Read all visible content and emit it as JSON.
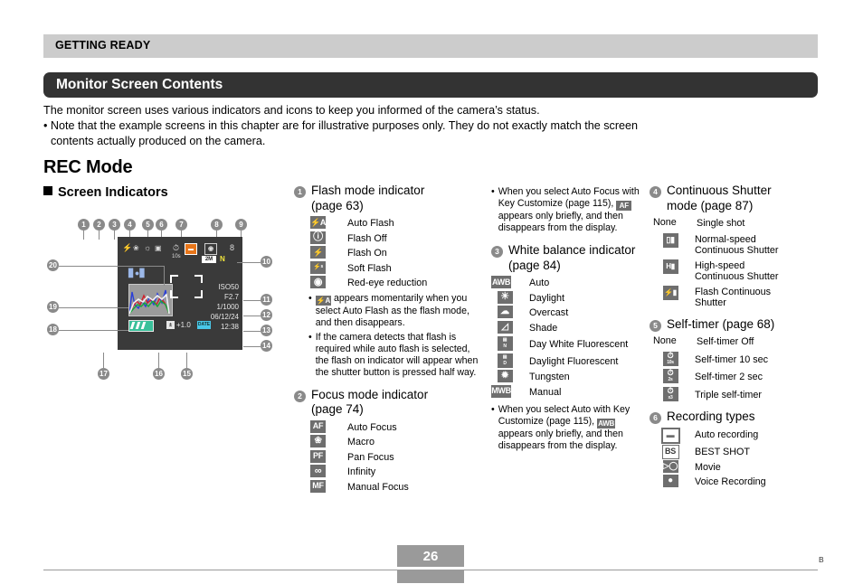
{
  "chapter_bar": {
    "label": "GETTING READY"
  },
  "title_bar": {
    "label": "Monitor Screen Contents"
  },
  "intro": {
    "line1": "The monitor screen uses various indicators and icons to keep you informed of the camera’s status.",
    "line2": "• Note that the example screens in this chapter are for illustrative purposes only. They do not exactly match the screen",
    "line3": "contents actually produced on the camera."
  },
  "headings": {
    "h1": "REC Mode",
    "h2": "Screen Indicators"
  },
  "screen": {
    "indicator_numbers": [
      "1",
      "2",
      "3",
      "4",
      "5",
      "6",
      "7",
      "8",
      "9",
      "10",
      "11",
      "12",
      "13",
      "14",
      "15",
      "16",
      "17",
      "18",
      "19",
      "20"
    ],
    "values": {
      "self_timer": "10s",
      "memory_left": "8",
      "image_size": "2M",
      "quality": "N",
      "iso": "ISO50",
      "aperture": "F2.7",
      "shutter": "1/1000",
      "date": "06/12/24",
      "time": "12:38",
      "ev": "+1.0",
      "date_stamp": "DATE"
    }
  },
  "sections": {
    "flash": {
      "number": "1",
      "title": "Flash mode indicator (page 63)",
      "title_l1": "Flash mode indicator",
      "title_l2": "(page 63)",
      "items": [
        {
          "icon": "flash-auto-icon",
          "glyph": "⚡A",
          "label": "Auto Flash"
        },
        {
          "icon": "flash-off-icon",
          "glyph": "ⓧ",
          "label": "Flash Off"
        },
        {
          "icon": "flash-on-icon",
          "glyph": "⚡",
          "label": "Flash On"
        },
        {
          "icon": "soft-flash-icon",
          "glyph": "⚡s",
          "label": "Soft Flash"
        },
        {
          "icon": "red-eye-icon",
          "glyph": "◉",
          "label": "Red-eye reduction"
        }
      ],
      "notes": [
        "appears momentarily when you select Auto Flash as the flash mode, and then disappears.",
        "If the camera detects that flash is required while auto flash is selected, the flash on indicator will appear when the shutter button is pressed half way."
      ]
    },
    "focus": {
      "number": "2",
      "title_l1": "Focus mode indicator",
      "title_l2": "(page 74)",
      "items": [
        {
          "icon": "auto-focus-icon",
          "glyph": "AF",
          "label": "Auto Focus"
        },
        {
          "icon": "macro-icon",
          "glyph": "❀",
          "label": "Macro"
        },
        {
          "icon": "pan-focus-icon",
          "glyph": "PF",
          "label": "Pan Focus"
        },
        {
          "icon": "infinity-icon",
          "glyph": "∞",
          "label": "Infinity"
        },
        {
          "icon": "manual-focus-icon",
          "glyph": "MF",
          "label": "Manual Focus"
        }
      ],
      "note": "When you select Auto Focus with Key Customize (page 115), AF appears only briefly, and then disappears from the display.",
      "note_pre": "When you select Auto Focus with Key Customize (page",
      "note_mid": "115),",
      "note_post": "appears only briefly, and then disappears from the display.",
      "note_glyph": "AF"
    },
    "white_balance": {
      "number": "3",
      "title_l1": "White balance indicator",
      "title_l2": "(page 84)",
      "items": [
        {
          "icon": "awb-icon",
          "glyph": "AWB",
          "label": "Auto"
        },
        {
          "icon": "daylight-icon",
          "glyph": "☀",
          "label": "Daylight"
        },
        {
          "icon": "overcast-icon",
          "glyph": "☁",
          "label": "Overcast"
        },
        {
          "icon": "shade-icon",
          "glyph": "◢",
          "label": "Shade"
        },
        {
          "icon": "day-white-fluorescent-icon",
          "glyph": "N",
          "label": "Day White Fluorescent"
        },
        {
          "icon": "daylight-fluorescent-icon",
          "glyph": "D",
          "label": "Daylight Fluorescent"
        },
        {
          "icon": "tungsten-icon",
          "glyph": "✹",
          "label": "Tungsten"
        },
        {
          "icon": "mwb-icon",
          "glyph": "MWB",
          "label": "Manual"
        }
      ],
      "note_pre": "When you select Auto with Key Customize (page 115),",
      "note_glyph": "AWB",
      "note_post": "appears only briefly, and then disappears from the display."
    },
    "continuous_shutter": {
      "number": "4",
      "title_l1": "Continuous Shutter",
      "title_l2": "mode (page 87)",
      "items": [
        {
          "icon": "none-label",
          "glyph": "None",
          "label": "Single shot"
        },
        {
          "icon": "normal-speed-continuous-icon",
          "glyph": "▣",
          "label_l1": "Normal-speed",
          "label_l2": "Continuous Shutter"
        },
        {
          "icon": "high-speed-continuous-icon",
          "glyph": "H",
          "label_l1": "High-speed",
          "label_l2": "Continuous Shutter"
        },
        {
          "icon": "flash-continuous-icon",
          "glyph": "⚡",
          "label_l1": "Flash Continuous",
          "label_l2": "Shutter"
        }
      ]
    },
    "self_timer": {
      "number": "5",
      "title_l1": "Self-timer (page 68)",
      "items": [
        {
          "icon": "none-label",
          "glyph": "None",
          "label": "Self-timer Off"
        },
        {
          "icon": "self-timer-10s-icon",
          "glyph": "10s",
          "label": "Self-timer 10 sec"
        },
        {
          "icon": "self-timer-2s-icon",
          "glyph": "2s",
          "label": "Self-timer 2 sec"
        },
        {
          "icon": "triple-self-timer-icon",
          "glyph": "x3",
          "label": "Triple self-timer"
        }
      ]
    },
    "recording_types": {
      "number": "6",
      "title_l1": "Recording types",
      "items": [
        {
          "icon": "auto-recording-icon",
          "glyph": "▭",
          "label": "Auto recording"
        },
        {
          "icon": "best-shot-icon",
          "glyph": "BS",
          "label": "BEST SHOT"
        },
        {
          "icon": "movie-icon",
          "glyph": "▶",
          "label": "Movie"
        },
        {
          "icon": "voice-recording-icon",
          "glyph": "♉",
          "label": "Voice Recording"
        }
      ]
    }
  },
  "footer": {
    "page_number": "26",
    "mark": "B"
  },
  "colors": {
    "chapter_bar_bg": "#cccccc",
    "title_bar_bg": "#333333",
    "callout_gray": "#8a8a8a",
    "icon_gray": "#6e6e6e",
    "lcd_bg": "#3a3a3a",
    "accent_orange": "#e8761a",
    "quality_yellow": "#f2e63c",
    "battery_green": "#3ac09a",
    "date_cyan": "#49c7e8"
  }
}
